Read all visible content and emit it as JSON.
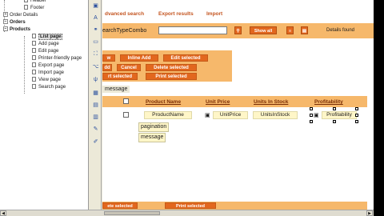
{
  "tree": {
    "items": [
      {
        "label": "Header",
        "indent": 2,
        "type": "page"
      },
      {
        "label": "Footer",
        "indent": 2,
        "type": "page"
      },
      {
        "label": "Order Details",
        "indent": 1,
        "type": "expand"
      },
      {
        "label": "Orders",
        "indent": 1,
        "type": "expand",
        "bold": true
      },
      {
        "label": "Products",
        "indent": 1,
        "type": "expand",
        "bold": true
      },
      {
        "label": "List page",
        "indent": 2,
        "type": "page",
        "bold": true,
        "selected": true
      },
      {
        "label": "Add page",
        "indent": 2,
        "type": "page"
      },
      {
        "label": "Edit page",
        "indent": 2,
        "type": "page"
      },
      {
        "label": "Printer-friendly page",
        "indent": 2,
        "type": "page"
      },
      {
        "label": "Export page",
        "indent": 2,
        "type": "page"
      },
      {
        "label": "Import page",
        "indent": 2,
        "type": "page"
      },
      {
        "label": "View page",
        "indent": 2,
        "type": "page"
      },
      {
        "label": "Search page",
        "indent": 2,
        "type": "page"
      }
    ]
  },
  "links": {
    "advanced_search": "dvanced search",
    "export_results": "Export results",
    "import": "Import"
  },
  "search": {
    "label": "earchTypeCombo",
    "value": "",
    "show_all": "Show all",
    "details_found": "Details found"
  },
  "actions": {
    "select_add": "Inline Add",
    "edit_selected": "Edit selected",
    "add": "dd",
    "cancel": "Cancel",
    "delete_selected": "Delete selected",
    "save_selected": "rt selected",
    "print_selected": "Print selected"
  },
  "message": "message",
  "grid": {
    "headers": [
      "Product Name",
      "Unit Price",
      "Units In Stock",
      "Profitability"
    ],
    "row": [
      "ProductName",
      "UnitPrice",
      "UnitsInStock",
      "Profitability"
    ]
  },
  "pager": {
    "pagination": "pagination",
    "message": "message"
  },
  "footer": {
    "delete_selected": "ete selected",
    "print_selected": "Print selected"
  },
  "colors": {
    "orange_panel": "#f6b86b",
    "orange_button": "#e2671e",
    "link": "#c4541f",
    "field_bg": "#fff6c8"
  }
}
